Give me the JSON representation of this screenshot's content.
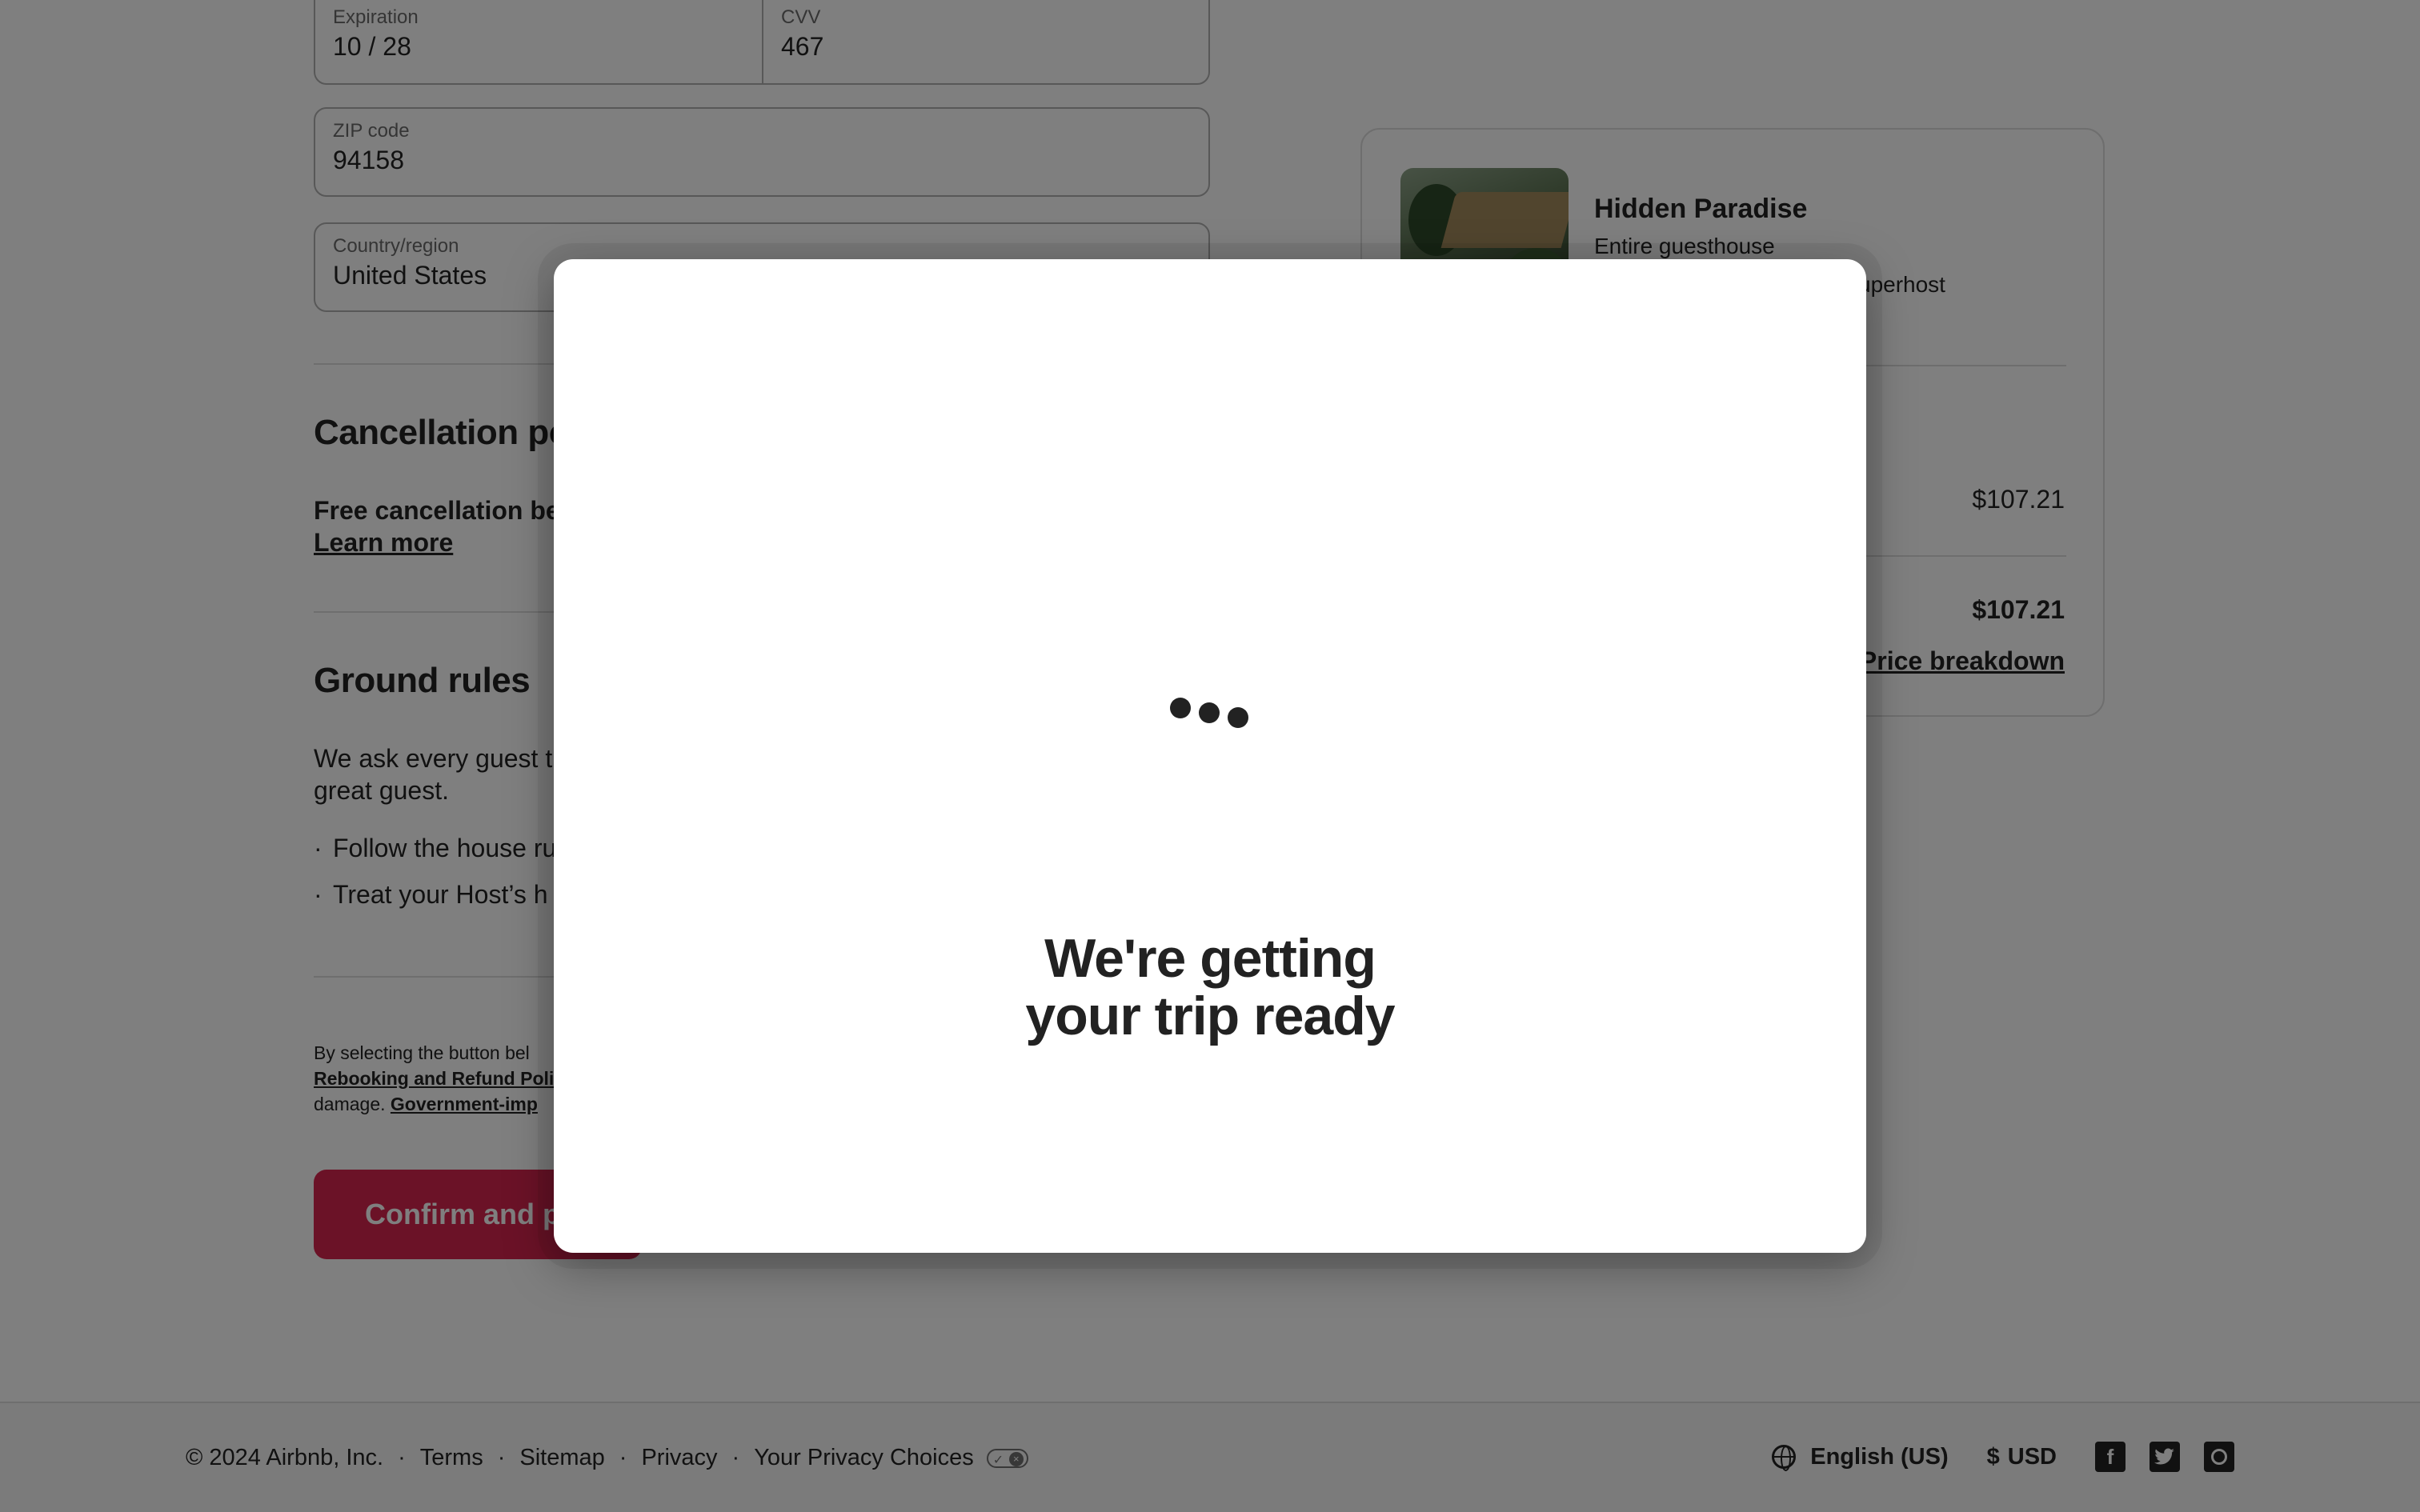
{
  "payment": {
    "expiration_label": "Expiration",
    "expiration_value": "10 / 28",
    "cvv_label": "CVV",
    "cvv_value": "467",
    "zip_label": "ZIP code",
    "zip_value": "94158",
    "country_label": "Country/region",
    "country_value": "United States"
  },
  "cancellation": {
    "heading": "Cancellation po",
    "text_bold": "Free cancellation be",
    "learn_more": "Learn more"
  },
  "ground_rules": {
    "heading": "Ground rules",
    "intro_line1": "We ask every guest t",
    "intro_line2": "great guest.",
    "bullets": [
      "Follow the house ru",
      "Treat your Host’s h"
    ]
  },
  "legal": {
    "line1": "By selecting the button bel",
    "link1": "Rebooking and Refund Poli",
    "line3_start": "damage.",
    "link2": "Government-imp"
  },
  "confirm_button": "Confirm and p",
  "listing": {
    "title": "Hidden Paradise",
    "subtitle": "Entire guesthouse",
    "host_fragment": "uperhost",
    "price_line": "$107.21",
    "total": "$107.21",
    "breakdown_link": "Price breakdown"
  },
  "footer": {
    "copyright": "© 2024 Airbnb, Inc.",
    "links": [
      "Terms",
      "Sitemap",
      "Privacy",
      "Your Privacy Choices"
    ],
    "language": "English (US)",
    "currency_symbol": "$",
    "currency": "USD",
    "social_icons": [
      "facebook-icon",
      "twitter-icon",
      "instagram-icon"
    ]
  },
  "modal": {
    "title_line1": "We're getting",
    "title_line2": "your trip ready",
    "loader_icon": "loading-dots-icon"
  },
  "colors": {
    "brand": "#d7254f",
    "overlay": "rgba(0,0,0,0.5)"
  }
}
